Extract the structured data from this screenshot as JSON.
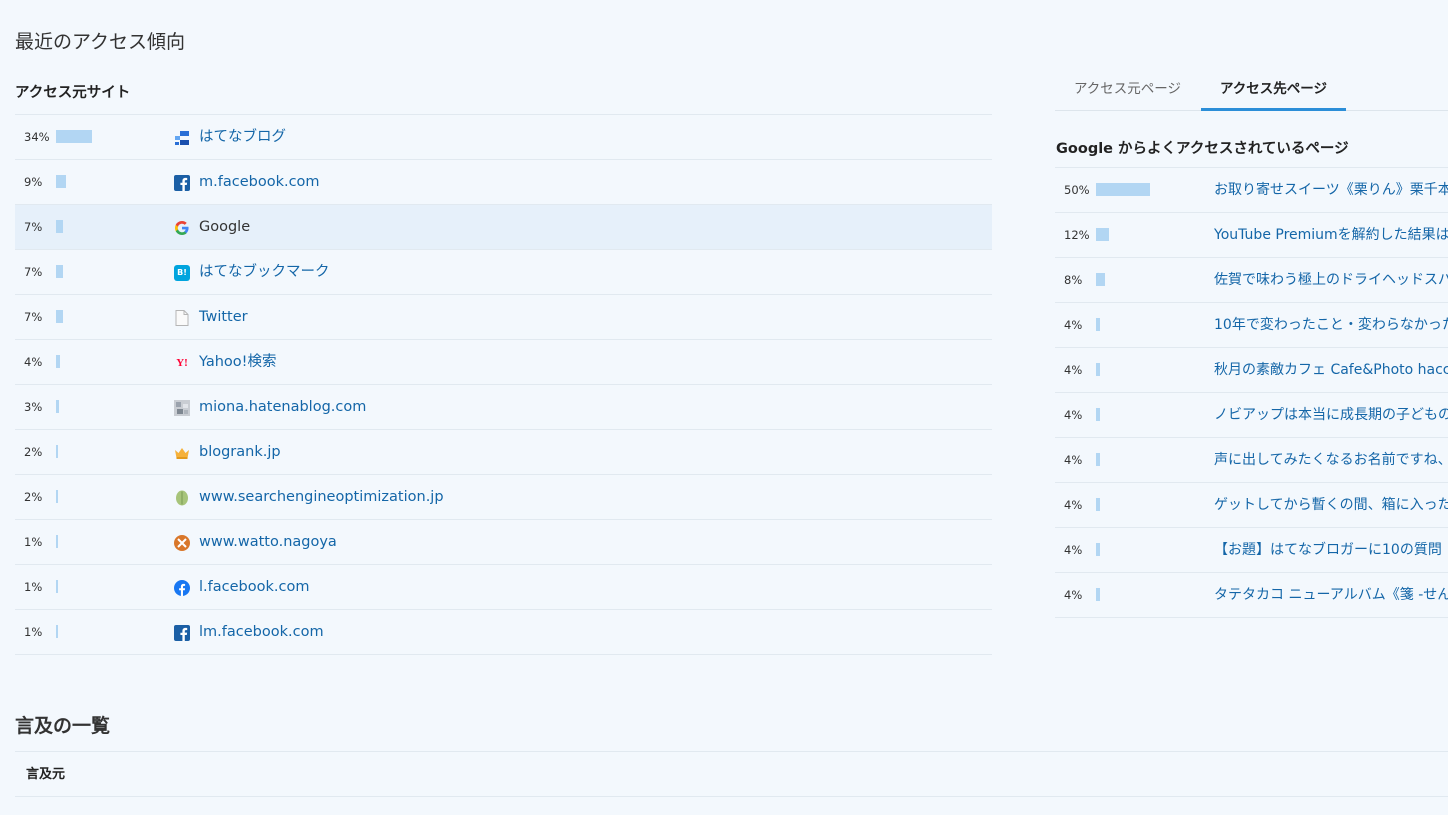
{
  "title": "最近のアクセス傾向",
  "sources": {
    "heading": "アクセス元サイト",
    "rows": [
      {
        "pct": "34%",
        "value": 34,
        "name": "はてなブログ",
        "icon": "hatena-blog-icon"
      },
      {
        "pct": "9%",
        "value": 9,
        "name": "m.facebook.com",
        "icon": "facebook-icon"
      },
      {
        "pct": "7%",
        "value": 7,
        "name": "Google",
        "icon": "google-icon"
      },
      {
        "pct": "7%",
        "value": 7,
        "name": "はてなブックマーク",
        "icon": "hatena-bookmark-icon"
      },
      {
        "pct": "7%",
        "value": 7,
        "name": "Twitter",
        "icon": "document-icon"
      },
      {
        "pct": "4%",
        "value": 4,
        "name": "Yahoo!検索",
        "icon": "yahoo-icon"
      },
      {
        "pct": "3%",
        "value": 3,
        "name": "miona.hatenablog.com",
        "icon": "site-thumbnail-icon"
      },
      {
        "pct": "2%",
        "value": 2,
        "name": "blogrank.jp",
        "icon": "crown-icon"
      },
      {
        "pct": "2%",
        "value": 2,
        "name": "www.searchengineoptimization.jp",
        "icon": "leaf-icon"
      },
      {
        "pct": "1%",
        "value": 1,
        "name": "www.watto.nagoya",
        "icon": "watto-icon"
      },
      {
        "pct": "1%",
        "value": 1,
        "name": "l.facebook.com",
        "icon": "facebook-round-icon"
      },
      {
        "pct": "1%",
        "value": 1,
        "name": "lm.facebook.com",
        "icon": "facebook-icon"
      }
    ]
  },
  "tabs": [
    {
      "label": "アクセス元ページ",
      "active": false
    },
    {
      "label": "アクセス先ページ",
      "active": true
    }
  ],
  "pages": {
    "heading": "Google からよくアクセスされているページ",
    "rows": [
      {
        "pct": "50%",
        "value": 50,
        "title": "お取り寄せスイーツ《栗りん》栗千本"
      },
      {
        "pct": "12%",
        "value": 12,
        "title": "YouTube Premiumを解約した結果は"
      },
      {
        "pct": "8%",
        "value": 8,
        "title": "佐賀で味わう極上のドライヘッドスパ"
      },
      {
        "pct": "4%",
        "value": 4,
        "title": "10年で変わったこと・変わらなかった"
      },
      {
        "pct": "4%",
        "value": 4,
        "title": "秋月の素敵カフェ Cafe&Photo hacc"
      },
      {
        "pct": "4%",
        "value": 4,
        "title": "ノビアップは本当に成長期の子どもの"
      },
      {
        "pct": "4%",
        "value": 4,
        "title": "声に出してみたくなるお名前ですね、"
      },
      {
        "pct": "4%",
        "value": 4,
        "title": "ゲットしてから暫くの間、箱に入った"
      },
      {
        "pct": "4%",
        "value": 4,
        "title": "【お題】はてなブロガーに10の質問"
      },
      {
        "pct": "4%",
        "value": 4,
        "title": "タテタカコ ニューアルバム《箋 -せん"
      }
    ]
  },
  "mentions": {
    "title": "言及の一覧",
    "column": "言及元"
  },
  "colors": {
    "bar": "#b2d6f3",
    "link": "#1466a8",
    "accent": "#2b8ed8"
  }
}
